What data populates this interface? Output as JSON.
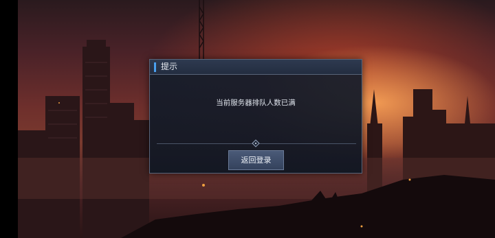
{
  "dialog": {
    "title": "提示",
    "message": "当前服务器排队人数已满",
    "button_label": "返回登录"
  },
  "colors": {
    "accent": "#4aa0f0",
    "dialog_bg": "#18202e",
    "dialog_border": "#59657a",
    "button_bg": "#3e4d6a"
  }
}
